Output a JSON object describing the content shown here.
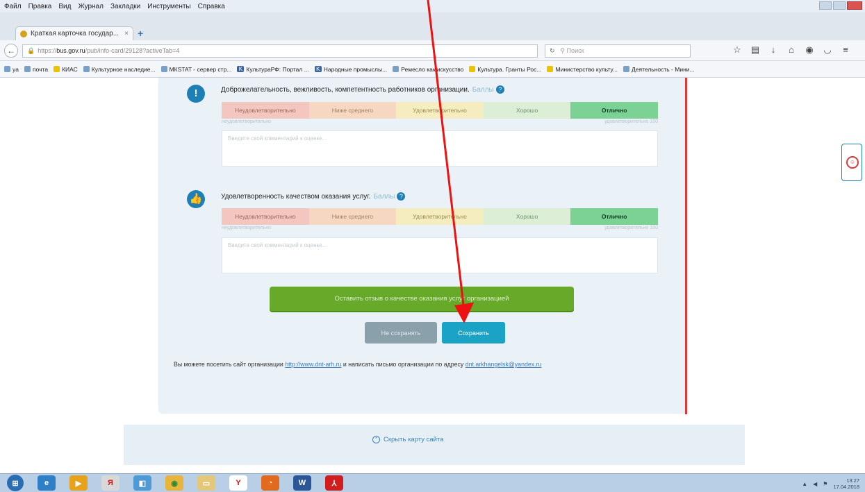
{
  "browser": {
    "menu": [
      "Файл",
      "Правка",
      "Вид",
      "Журнал",
      "Закладки",
      "Инструменты",
      "Справка"
    ],
    "tab_title": "Краткая карточка государ...",
    "url_prefix": "https://",
    "url_host": "bus.gov.ru",
    "url_path": "/pub/info-card/29128?activeTab=4",
    "search_placeholder": "Поиск",
    "bookmarks": [
      "ya",
      "почта",
      "КИАС",
      "Культурное наследие...",
      "МКSTAT - сервер стр...",
      "КультураРФ: Портал ...",
      "Народные промыслы...",
      "Ремесло как искусство",
      "Культура. Гранты Рос...",
      "Министерство культу...",
      "Деятельность - Мини..."
    ]
  },
  "questions": [
    {
      "icon": "info-icon",
      "title": "Доброжелательность, вежливость, компетентность работников организации.",
      "score_label": "Баллы",
      "comment_placeholder": "Введите свой комментарий к оценке..."
    },
    {
      "icon": "thumbs-up-icon",
      "title": "Удовлетворенность качеством оказания услуг.",
      "score_label": "Баллы",
      "comment_placeholder": "Введите свой комментарий к оценке..."
    }
  ],
  "scale": [
    "Неудовлетворительно",
    "Ниже среднего",
    "Удовлетворительно",
    "Хорошо",
    "Отлично"
  ],
  "scale_sub_left": "неудовлетворительно",
  "scale_sub_right": "удовлетворительно 100",
  "selected_rating": "Отлично",
  "buttons": {
    "leave_review": "Оставить отзыв о качестве оказания услуг организацией",
    "dont_save": "Не сохранять",
    "save": "Сохранить"
  },
  "visit": {
    "text_before": "Вы можете посетить сайт организации",
    "site_link": "http://www.dnt-arh.ru",
    "text_middle": "и написать письмо организации по адресу",
    "email_link": "dnt.arkhangelsk@yandex.ru"
  },
  "sitemap_toggle": "Скрыть карту сайта",
  "tray": {
    "time": "13:27",
    "date": "17.04.2018"
  },
  "colors": {
    "annotation_arrow": "#ee1111",
    "save_button": "#1ba3c6",
    "green_button": "#67aa2a"
  }
}
